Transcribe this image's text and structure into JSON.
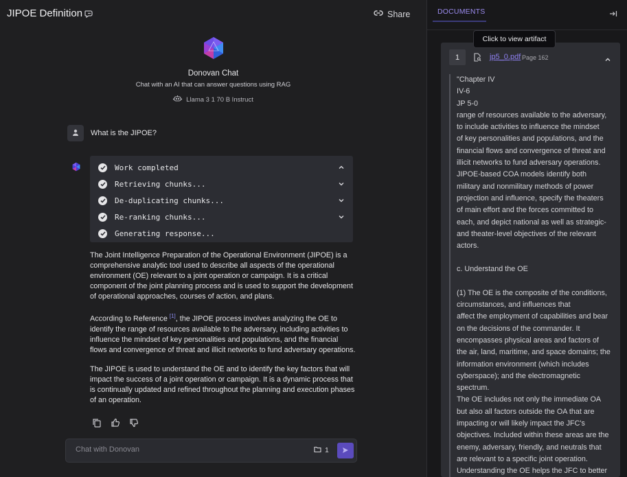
{
  "header": {
    "title": "JIPOE Definition",
    "share_label": "Share"
  },
  "hero": {
    "name": "Donovan Chat",
    "description": "Chat with an AI that can answer questions using RAG",
    "model": "Llama 3 1 70 B Instruct"
  },
  "conversation": {
    "user_question": "What is the JIPOE?",
    "steps": [
      {
        "label": "Work completed",
        "chevron": "up"
      },
      {
        "label": "Retrieving chunks...",
        "chevron": "down"
      },
      {
        "label": "De-duplicating chunks...",
        "chevron": "down"
      },
      {
        "label": "Re-ranking chunks...",
        "chevron": "down"
      },
      {
        "label": "Generating response...",
        "chevron": ""
      }
    ],
    "answer": {
      "p1": "The Joint Intelligence Preparation of the Operational Environment (JIPOE) is a comprehensive analytic tool used to describe all aspects of the operational environment (OE) relevant to a joint operation or campaign. It is a critical component of the joint planning process and is used to support the development of operational approaches, courses of action, and plans.",
      "p2_pre": "According to Reference ",
      "p2_ref": "[1]",
      "p2_post": ", the JIPOE process involves analyzing the OE to identify the range of resources available to the adversary, including activities to influence the mindset of key personalities and populations, and the financial flows and convergence of threat and illicit networks to fund adversary operations.",
      "p3": "The JIPOE is used to understand the OE and to identify the key factors that will impact the success of a joint operation or campaign. It is a dynamic process that is continually updated and refined throughout the planning and execution phases of an operation."
    }
  },
  "composer": {
    "placeholder": "Chat with Donovan",
    "attachment_count": "1"
  },
  "documents": {
    "tab_label": "DOCUMENTS",
    "tooltip": "Click to view artifact",
    "item": {
      "index": "1",
      "filename": "jp5_0.pdf",
      "page": "Page 162",
      "excerpt_lines": [
        "\"Chapter IV",
        "IV-6",
        "JP 5-0",
        "range of resources available to the adversary,",
        "to include activities to influence the mindset",
        "of key personalities and populations, and the",
        "financial flows and convergence of threat and",
        "illicit networks to fund adversary operations.",
        "JIPOE-based COA models identify both",
        "military and nonmilitary methods of power",
        "projection and influence, specify the theaters",
        "of main effort and the forces committed to",
        "each, and depict national as well as strategic-",
        "and theater-level objectives of the relevant",
        "actors.",
        "",
        "c. Understand the OE",
        "",
        "(1) The OE is the composite of the conditions,",
        "circumstances, and influences that",
        "affect the employment of capabilities and bear",
        "on the decisions of the commander. It",
        "encompasses physical areas and factors of",
        "the air, land, maritime, and space domains; the",
        "information environment (which includes",
        "cyberspace); and the electromagnetic",
        "spectrum.",
        "The OE includes not only the immediate OA",
        "but also all factors outside the OA that are",
        "impacting or will likely impact the JFC's",
        "objectives. Included within these areas are the",
        "enemy, adversary, friendly, and neutrals that",
        "are relevant to a specific joint operation.",
        "Understanding the OE helps the JFC to better"
      ]
    }
  },
  "colors": {
    "accent": "#5b4bbd",
    "link": "#8e80f0",
    "bg": "#1f1f21",
    "panel": "#2d2e33"
  }
}
